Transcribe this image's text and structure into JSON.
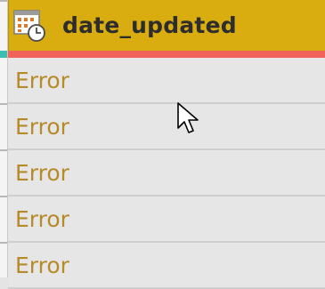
{
  "column": {
    "name": "date_updated",
    "type_icon": "datetime-icon",
    "header_color": "#d9ad0f",
    "quality_color": "#f1645a"
  },
  "rows": [
    {
      "value": "Error"
    },
    {
      "value": "Error"
    },
    {
      "value": "Error"
    },
    {
      "value": "Error"
    },
    {
      "value": "Error"
    }
  ],
  "colors": {
    "error_text": "#b68a2a",
    "cell_background": "#e6e6e6"
  }
}
